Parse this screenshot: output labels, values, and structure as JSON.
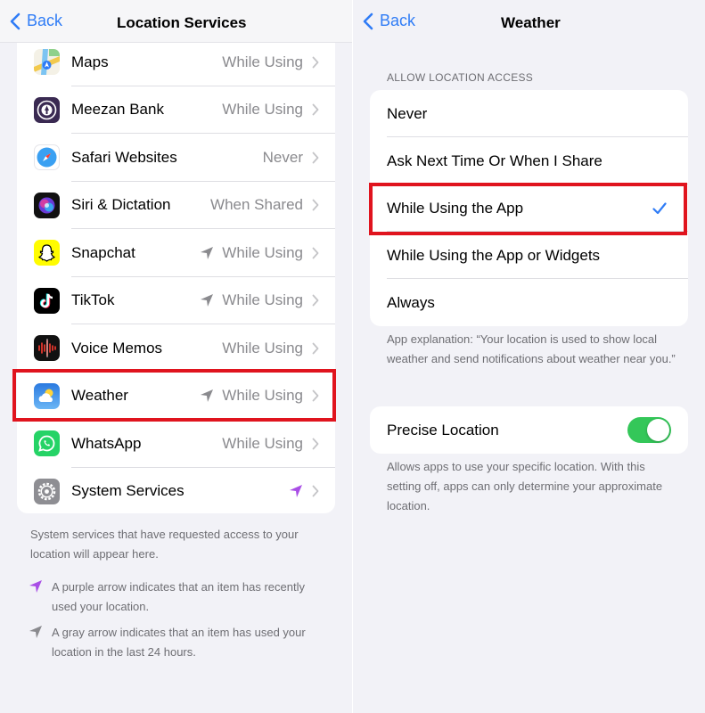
{
  "left": {
    "nav": {
      "back": "Back",
      "title": "Location Services"
    },
    "apps": [
      {
        "name": "Maps",
        "value": "While Using",
        "arrow": "none",
        "icon": "maps-icon"
      },
      {
        "name": "Meezan Bank",
        "value": "While Using",
        "arrow": "none",
        "icon": "meezan-bank-icon"
      },
      {
        "name": "Safari Websites",
        "value": "Never",
        "arrow": "none",
        "icon": "safari-icon"
      },
      {
        "name": "Siri & Dictation",
        "value": "When Shared",
        "arrow": "none",
        "icon": "siri-icon"
      },
      {
        "name": "Snapchat",
        "value": "While Using",
        "arrow": "gray",
        "icon": "snapchat-icon"
      },
      {
        "name": "TikTok",
        "value": "While Using",
        "arrow": "gray",
        "icon": "tiktok-icon"
      },
      {
        "name": "Voice Memos",
        "value": "While Using",
        "arrow": "none",
        "icon": "voice-memos-icon"
      },
      {
        "name": "Weather",
        "value": "While Using",
        "arrow": "gray",
        "icon": "weather-icon"
      },
      {
        "name": "WhatsApp",
        "value": "While Using",
        "arrow": "none",
        "icon": "whatsapp-icon"
      },
      {
        "name": "System Services",
        "value": "",
        "arrow": "purple",
        "icon": "gear-icon"
      }
    ],
    "footer": {
      "system_note": "System services that have requested access to your location will appear here.",
      "purple_note": "A purple arrow indicates that an item has recently used your location.",
      "gray_note": "A gray arrow indicates that an item has used your location in the last 24 hours."
    }
  },
  "right": {
    "nav": {
      "back": "Back",
      "title": "Weather"
    },
    "section_header": "ALLOW LOCATION ACCESS",
    "options": [
      {
        "label": "Never",
        "selected": false
      },
      {
        "label": "Ask Next Time Or When I Share",
        "selected": false
      },
      {
        "label": "While Using the App",
        "selected": true
      },
      {
        "label": "While Using the App or Widgets",
        "selected": false
      },
      {
        "label": "Always",
        "selected": false
      }
    ],
    "explanation": "App explanation: “Your location is used to show local weather and send notifications about weather near you.”",
    "precise": {
      "label": "Precise Location",
      "enabled": true
    },
    "precise_note": "Allows apps to use your specific location. With this setting off, apps can only determine your approximate location."
  },
  "colors": {
    "accent": "#2f7cf6",
    "highlight": "#e0141e",
    "toggle_on": "#34c759",
    "purple_arrow": "#a94ee6",
    "gray_arrow": "#8a8a8e"
  }
}
